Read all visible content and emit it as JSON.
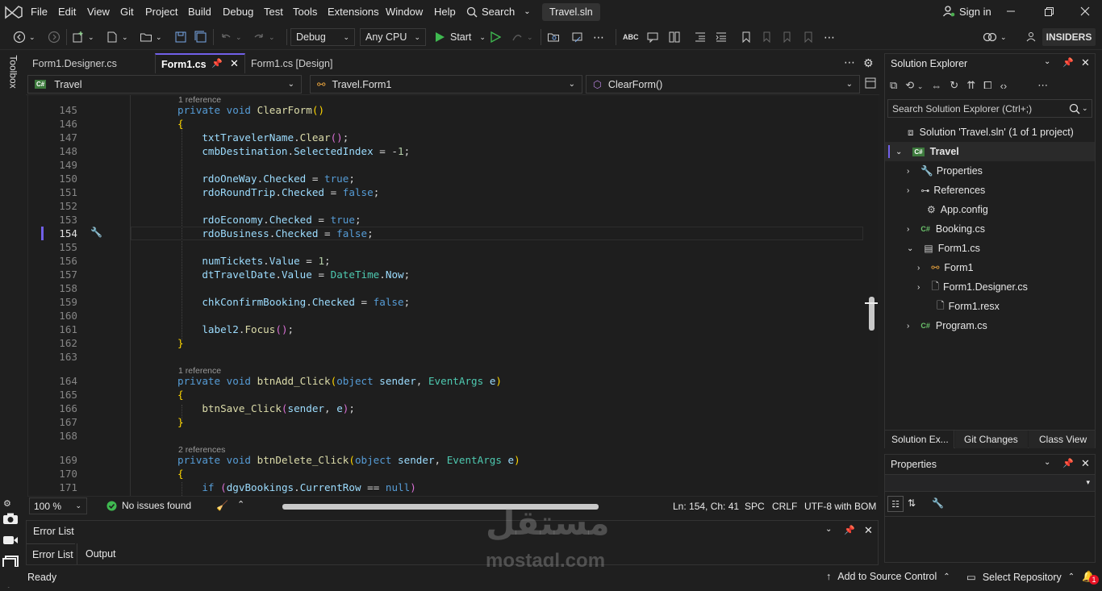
{
  "menu": {
    "items": [
      "File",
      "Edit",
      "View",
      "Git",
      "Project",
      "Build",
      "Debug",
      "Test",
      "Tools",
      "Extensions",
      "Window",
      "Help"
    ],
    "search_label": "Search",
    "solution_name": "Travel.sln",
    "sign_in": "Sign in"
  },
  "toolbar": {
    "config": "Debug",
    "platform": "Any CPU",
    "start": "Start",
    "insiders": "INSIDERS"
  },
  "left_rail": {
    "toolbox": "Toolbox"
  },
  "tabs": [
    {
      "label": "Form1.Designer.cs"
    },
    {
      "label": "Form1.cs"
    },
    {
      "label": "Form1.cs [Design]"
    }
  ],
  "navbar": {
    "project": "Travel",
    "class": "Travel.Form1",
    "member": "ClearForm()"
  },
  "code": {
    "ref1": "1 reference",
    "ref2": "1 reference",
    "ref3": "2 references",
    "line_numbers": [
      "145",
      "146",
      "147",
      "148",
      "149",
      "150",
      "151",
      "152",
      "153",
      "154",
      "155",
      "156",
      "157",
      "158",
      "159",
      "160",
      "161",
      "162",
      "163",
      "164",
      "165",
      "166",
      "167",
      "168",
      "169",
      "170",
      "171"
    ]
  },
  "editor_status": {
    "zoom": "100 %",
    "issues": "No issues found",
    "position": "Ln: 154, Ch: 41",
    "spc": "SPC",
    "crlf": "CRLF",
    "encoding": "UTF-8 with BOM"
  },
  "error_panel": {
    "title": "Error List",
    "tabs": [
      "Error List",
      "Output"
    ]
  },
  "solution_explorer": {
    "title": "Solution Explorer",
    "search_placeholder": "Search Solution Explorer (Ctrl+;)",
    "tree": [
      {
        "label": "Solution 'Travel.sln' (1 of 1 project)",
        "icon": "solution-icon"
      },
      {
        "label": "Travel",
        "icon": "csharp-project-icon"
      },
      {
        "label": "Properties",
        "icon": "wrench-icon"
      },
      {
        "label": "References",
        "icon": "references-icon"
      },
      {
        "label": "App.config",
        "icon": "config-icon"
      },
      {
        "label": "Booking.cs",
        "icon": "csharp-file-icon"
      },
      {
        "label": "Form1.cs",
        "icon": "form-icon"
      },
      {
        "label": "Form1",
        "icon": "class-icon"
      },
      {
        "label": "Form1.Designer.cs",
        "icon": "file-icon"
      },
      {
        "label": "Form1.resx",
        "icon": "file-icon"
      },
      {
        "label": "Program.cs",
        "icon": "csharp-file-icon"
      }
    ],
    "bottom_tabs": [
      "Solution Ex...",
      "Git Changes",
      "Class View"
    ]
  },
  "properties_panel": {
    "title": "Properties"
  },
  "status_bar": {
    "ready": "Ready",
    "add_source": "Add to Source Control",
    "select_repo": "Select Repository",
    "notifications": "1"
  },
  "watermark": {
    "arabic": "مستقل",
    "latin": "mostaql.com"
  },
  "colors": {
    "accent": "#7160e8",
    "keyword": "#569cd6",
    "type": "#4ec9b0",
    "method": "#dcdcaa",
    "identifier": "#9cdcfe"
  }
}
